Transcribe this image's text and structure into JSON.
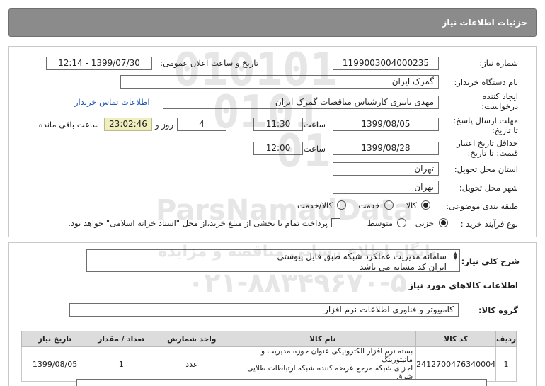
{
  "header": {
    "title": "جزئیات اطلاعات نیاز"
  },
  "form": {
    "need_number_label": "شماره نیاز:",
    "need_number": "1199003004000235",
    "announce_label": "تاریخ و ساعت اعلان عمومی:",
    "announce_value": "1399/07/30 - 12:14",
    "buyer_org_label": "نام دستگاه خریدار:",
    "buyer_org": "گمرک ایران",
    "creator_label_1": "ایجاد کننده",
    "creator_label_2": "درخواست:",
    "creator": "مهدی بابیری کارشناس مناقصات گمرک ایران",
    "contact_link": "اطلاعات تماس خریدار",
    "reply_deadline_label_1": "مهلت ارسال پاسخ:",
    "reply_deadline_label_2": "تا تاریخ:",
    "reply_date": "1399/08/05",
    "time_label": "ساعت",
    "reply_time": "11:30",
    "days_value": "4",
    "days_label": "روز و",
    "remaining_time": "23:02:46",
    "remaining_label": "ساعت باقی مانده",
    "validity_label_1": "حداقل تاریخ اعتبار",
    "validity_label_2": "قیمت: تا تاریخ:",
    "validity_date": "1399/08/28",
    "validity_time": "12:00",
    "province_label": "استان محل تحویل:",
    "province": "تهران",
    "city_label": "شهر محل تحویل:",
    "city": "تهران",
    "category_label": "طبقه بندی موضوعی:",
    "category_options": [
      "کالا",
      "خدمت",
      "کالا/خدمت"
    ],
    "category_selected": "کالا",
    "process_label": "نوع فرآیند خرید :",
    "process_options": [
      "جزیی",
      "متوسط"
    ],
    "process_selected": "جزیی",
    "payment_note": "پرداخت تمام یا بخشی از مبلغ خرید،از محل \"اسناد خزانه اسلامی\" خواهد بود."
  },
  "description": {
    "label": "شرح کلی نیاز:",
    "line1": "سامانه مدیریت عملکرد شبکه طبق فایل پیوستی",
    "line2": "ایران کد مشابه می باشد"
  },
  "goods": {
    "section_title": "اطلاعات کالاهای مورد نیاز",
    "group_label": "گروه کالا:",
    "group_value": "کامپیوتر و فناوری اطلاعات-نرم افزار",
    "columns": [
      "ردیف",
      "کد کالا",
      "نام کالا",
      "واحد شمارش",
      "تعداد / مقدار",
      "تاریخ نیاز"
    ],
    "rows": [
      {
        "index": "1",
        "code": "2412700476340004",
        "name_line1": "بسته نرم افزار الکترونیکی عنوان حوزه مدیریت و مانیتورینگ",
        "name_line2": "اجزای شبکه مرجع عرضه کننده شبکه ارتباطات طلایی شرق",
        "unit": "عدد",
        "qty": "1",
        "date": "1399/08/05"
      }
    ]
  },
  "watermark": {
    "line1": "ParsNamadData",
    "line2": "پایگاه اطلاع رسانی مناقصه و مزایده",
    "line3": "۰۲۱-۸۸۳۴۹۶۷۰-۵"
  }
}
